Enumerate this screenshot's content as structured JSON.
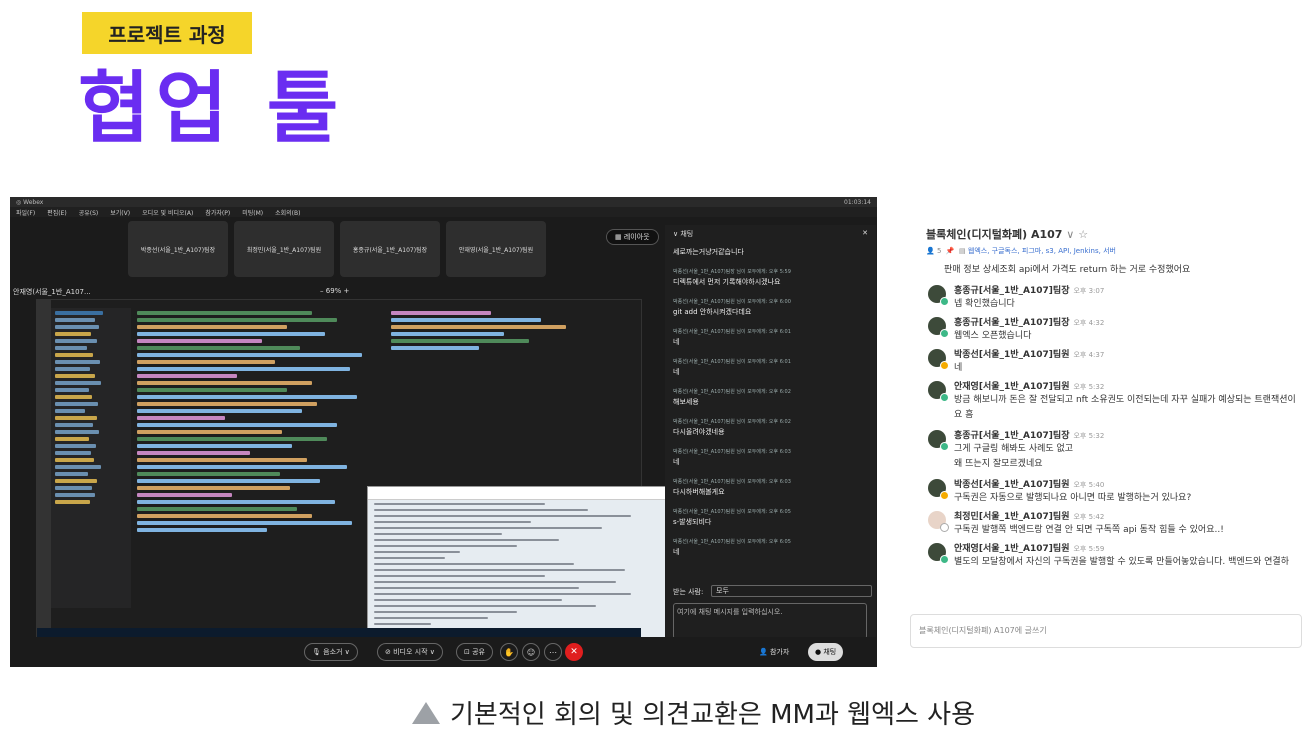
{
  "header": {
    "badge": "프로젝트 과정",
    "title": "협업 툴"
  },
  "webex": {
    "menu": [
      "파일(F)",
      "편집(E)",
      "공유(S)",
      "보기(V)",
      "오디오 및 비디오(A)",
      "참가자(P)",
      "미팅(M)",
      "소회의(B)"
    ],
    "clock": "01:03:14",
    "tiles": [
      "박종선(서울_1반_A107)팀장",
      "최정민(서울_1반_A107)팀원",
      "홍종규(서울_1반_A107)팀장",
      "안재영(서울_1반_A107)팀원"
    ],
    "layout_label": "레이아웃",
    "sharer": "안재영(서울_1반_A107...",
    "zoom": "69%",
    "chat": {
      "title": "채팅",
      "messages": [
        {
          "meta": "",
          "text": "세로까는거냥거같습니다"
        },
        {
          "meta": "박종선(서울_1반_A107)팀장 님이 모두에게: 오후 5:59",
          "text": "디렉튜에서 먼저 기록해야하시겠나요"
        },
        {
          "meta": "박종선(서울_1반_A107)팀원 님이 모두에게: 오후 6:00",
          "text": "git add 안하시켜겠다데요"
        },
        {
          "meta": "박종선(서울_1반_A107)팀원 님이 모두에게: 오후 6:01",
          "text": "네"
        },
        {
          "meta": "박종선(서울_1반_A107)팀원 님이 모두에게: 오후 6:01",
          "text": "네"
        },
        {
          "meta": "박종선(서울_1반_A107)팀원 님이 모두에게: 오후 6:02",
          "text": "해보세용"
        },
        {
          "meta": "박종선(서울_1반_A107)팀원 님이 모두에게: 오후 6:02",
          "text": "다시올려야겠네용"
        },
        {
          "meta": "박종선(서울_1반_A107)팀원 님이 모두에게: 오후 6:03",
          "text": "네"
        },
        {
          "meta": "박종선(서울_1반_A107)팀원 님이 모두에게: 오후 6:03",
          "text": "다시하버해볼게요"
        },
        {
          "meta": "박종선(서울_1반_A107)팀원 님이 모두에게: 오후 6:05",
          "text": "s-발생되비다"
        },
        {
          "meta": "박종선(서울_1반_A107)팀원 님이 모두에게: 오후 6:05",
          "text": "네"
        }
      ],
      "to_label": "받는 사람:",
      "to_value": "모두",
      "input_placeholder": "여기에 채팅 메시지를 입력하십시오."
    },
    "controls": {
      "mute": "음소거",
      "video": "비디오 시작",
      "share": "공유",
      "participants": "참가자",
      "chat": "채팅"
    }
  },
  "mattermost": {
    "channel": "블록체인(디지털화폐) A107",
    "member_count": "5",
    "links": "웹엑스, 구글독스, 피그마, s3, API, Jenkins, 서버",
    "top_line": "판매 정보 상세조회 api에서 가격도 return 하는 거로 수정했어요",
    "posts": [
      {
        "name": "홍종규[서울_1반_A107]팀장",
        "time": "오후 3:07",
        "text": "넵 확인했습니다",
        "cont": ""
      },
      {
        "name": "홍종규[서울_1반_A107]팀장",
        "time": "오후 4:32",
        "text": "웹엑스 오픈했습니다",
        "cont": ""
      },
      {
        "name": "박종선[서울_1반_A107]팀원",
        "time": "오후 4:37",
        "text": "네",
        "cont": ""
      },
      {
        "name": "안재영[서울_1반_A107]팀원",
        "time": "오후 5:32",
        "text": "방금 해보니까 돈은 잘 전달되고 nft 소유권도 이전되는데 자꾸 실패가 예상되는 트랜잭션이",
        "cont": "요 흠"
      },
      {
        "name": "홍종규[서울_1반_A107]팀장",
        "time": "오후 5:32",
        "text": "그게 구글링 해봐도 사례도 없고",
        "cont": "왜 뜨는지 잘모르겠네요"
      },
      {
        "name": "박종선[서울_1반_A107]팀원",
        "time": "오후 5:40",
        "text": "구독권은 자동으로 발행되나요 아니면 따로 발행하는거 있나요?",
        "cont": ""
      },
      {
        "name": "최정민[서울_1반_A107]팀원",
        "time": "오후 5:42",
        "text": "구독권 발행쪽 백엔드랑 연결 안 되면 구독쪽 api 동작 힘들 수 있어요..!",
        "cont": ""
      },
      {
        "name": "안재영[서울_1반_A107]팀원",
        "time": "오후 5:59",
        "text": "별도의 모달창에서 자신의 구독권을 발행할 수 있도록 만들어놓았습니다. 백엔드와 연결하",
        "cont": ""
      }
    ],
    "input_placeholder": "블록체인(디지털화폐) A107에 글쓰기"
  },
  "caption": "기본적인 회의 및 의견교환은 MM과 웹엑스 사용"
}
